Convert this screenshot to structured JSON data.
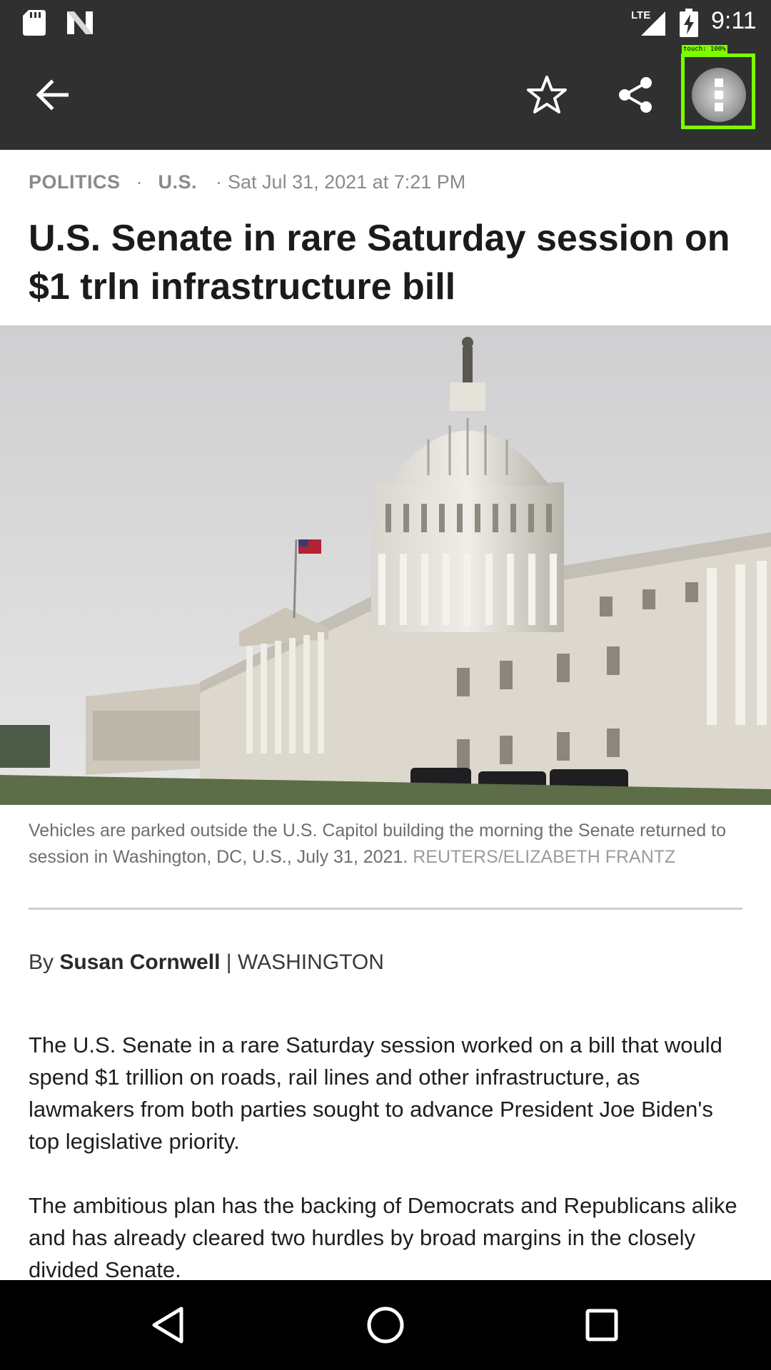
{
  "status_bar": {
    "time": "9:11",
    "network": "LTE",
    "icons": [
      "sd-card-icon",
      "n-notification-icon",
      "lte-signal-icon",
      "battery-charging-icon"
    ]
  },
  "app_bar": {
    "icons": [
      "back-arrow-icon",
      "star-icon",
      "share-icon",
      "more-vert-icon"
    ],
    "touch_indicator": "touch: 100%",
    "colors": {
      "background": "#303030",
      "foreground": "#ffffff",
      "touch_highlight": "#7cfc00"
    }
  },
  "article": {
    "category": "POLITICS",
    "region": "U.S.",
    "separator": "·",
    "date": "Sat Jul 31, 2021 at 7:21 PM",
    "headline": "U.S. Senate in rare Saturday session on $1 trln infrastructure bill",
    "photo_subject": "U.S. Capitol building with parked vehicles",
    "caption": "Vehicles are parked outside the U.S. Capitol building the morning the Senate returned to session in Washington, DC, U.S., July 31, 2021.",
    "caption_credit": "REUTERS/ELIZABETH FRANTZ",
    "byline_prefix": "By",
    "author": "Susan Cornwell",
    "byline_sep": "|",
    "location": "WASHINGTON",
    "paragraphs": [
      "The U.S. Senate in a rare Saturday session worked on a bill that would spend $1 trillion on roads, rail lines and other infrastructure, as lawmakers from both parties sought to advance President Joe Biden's top legislative priority.",
      "The ambitious plan has the backing of Democrats and Republicans alike and has already cleared two hurdles by broad margins in the closely divided Senate."
    ]
  },
  "nav_bar": {
    "icons": [
      "nav-back-icon",
      "nav-home-icon",
      "nav-recents-icon"
    ]
  }
}
